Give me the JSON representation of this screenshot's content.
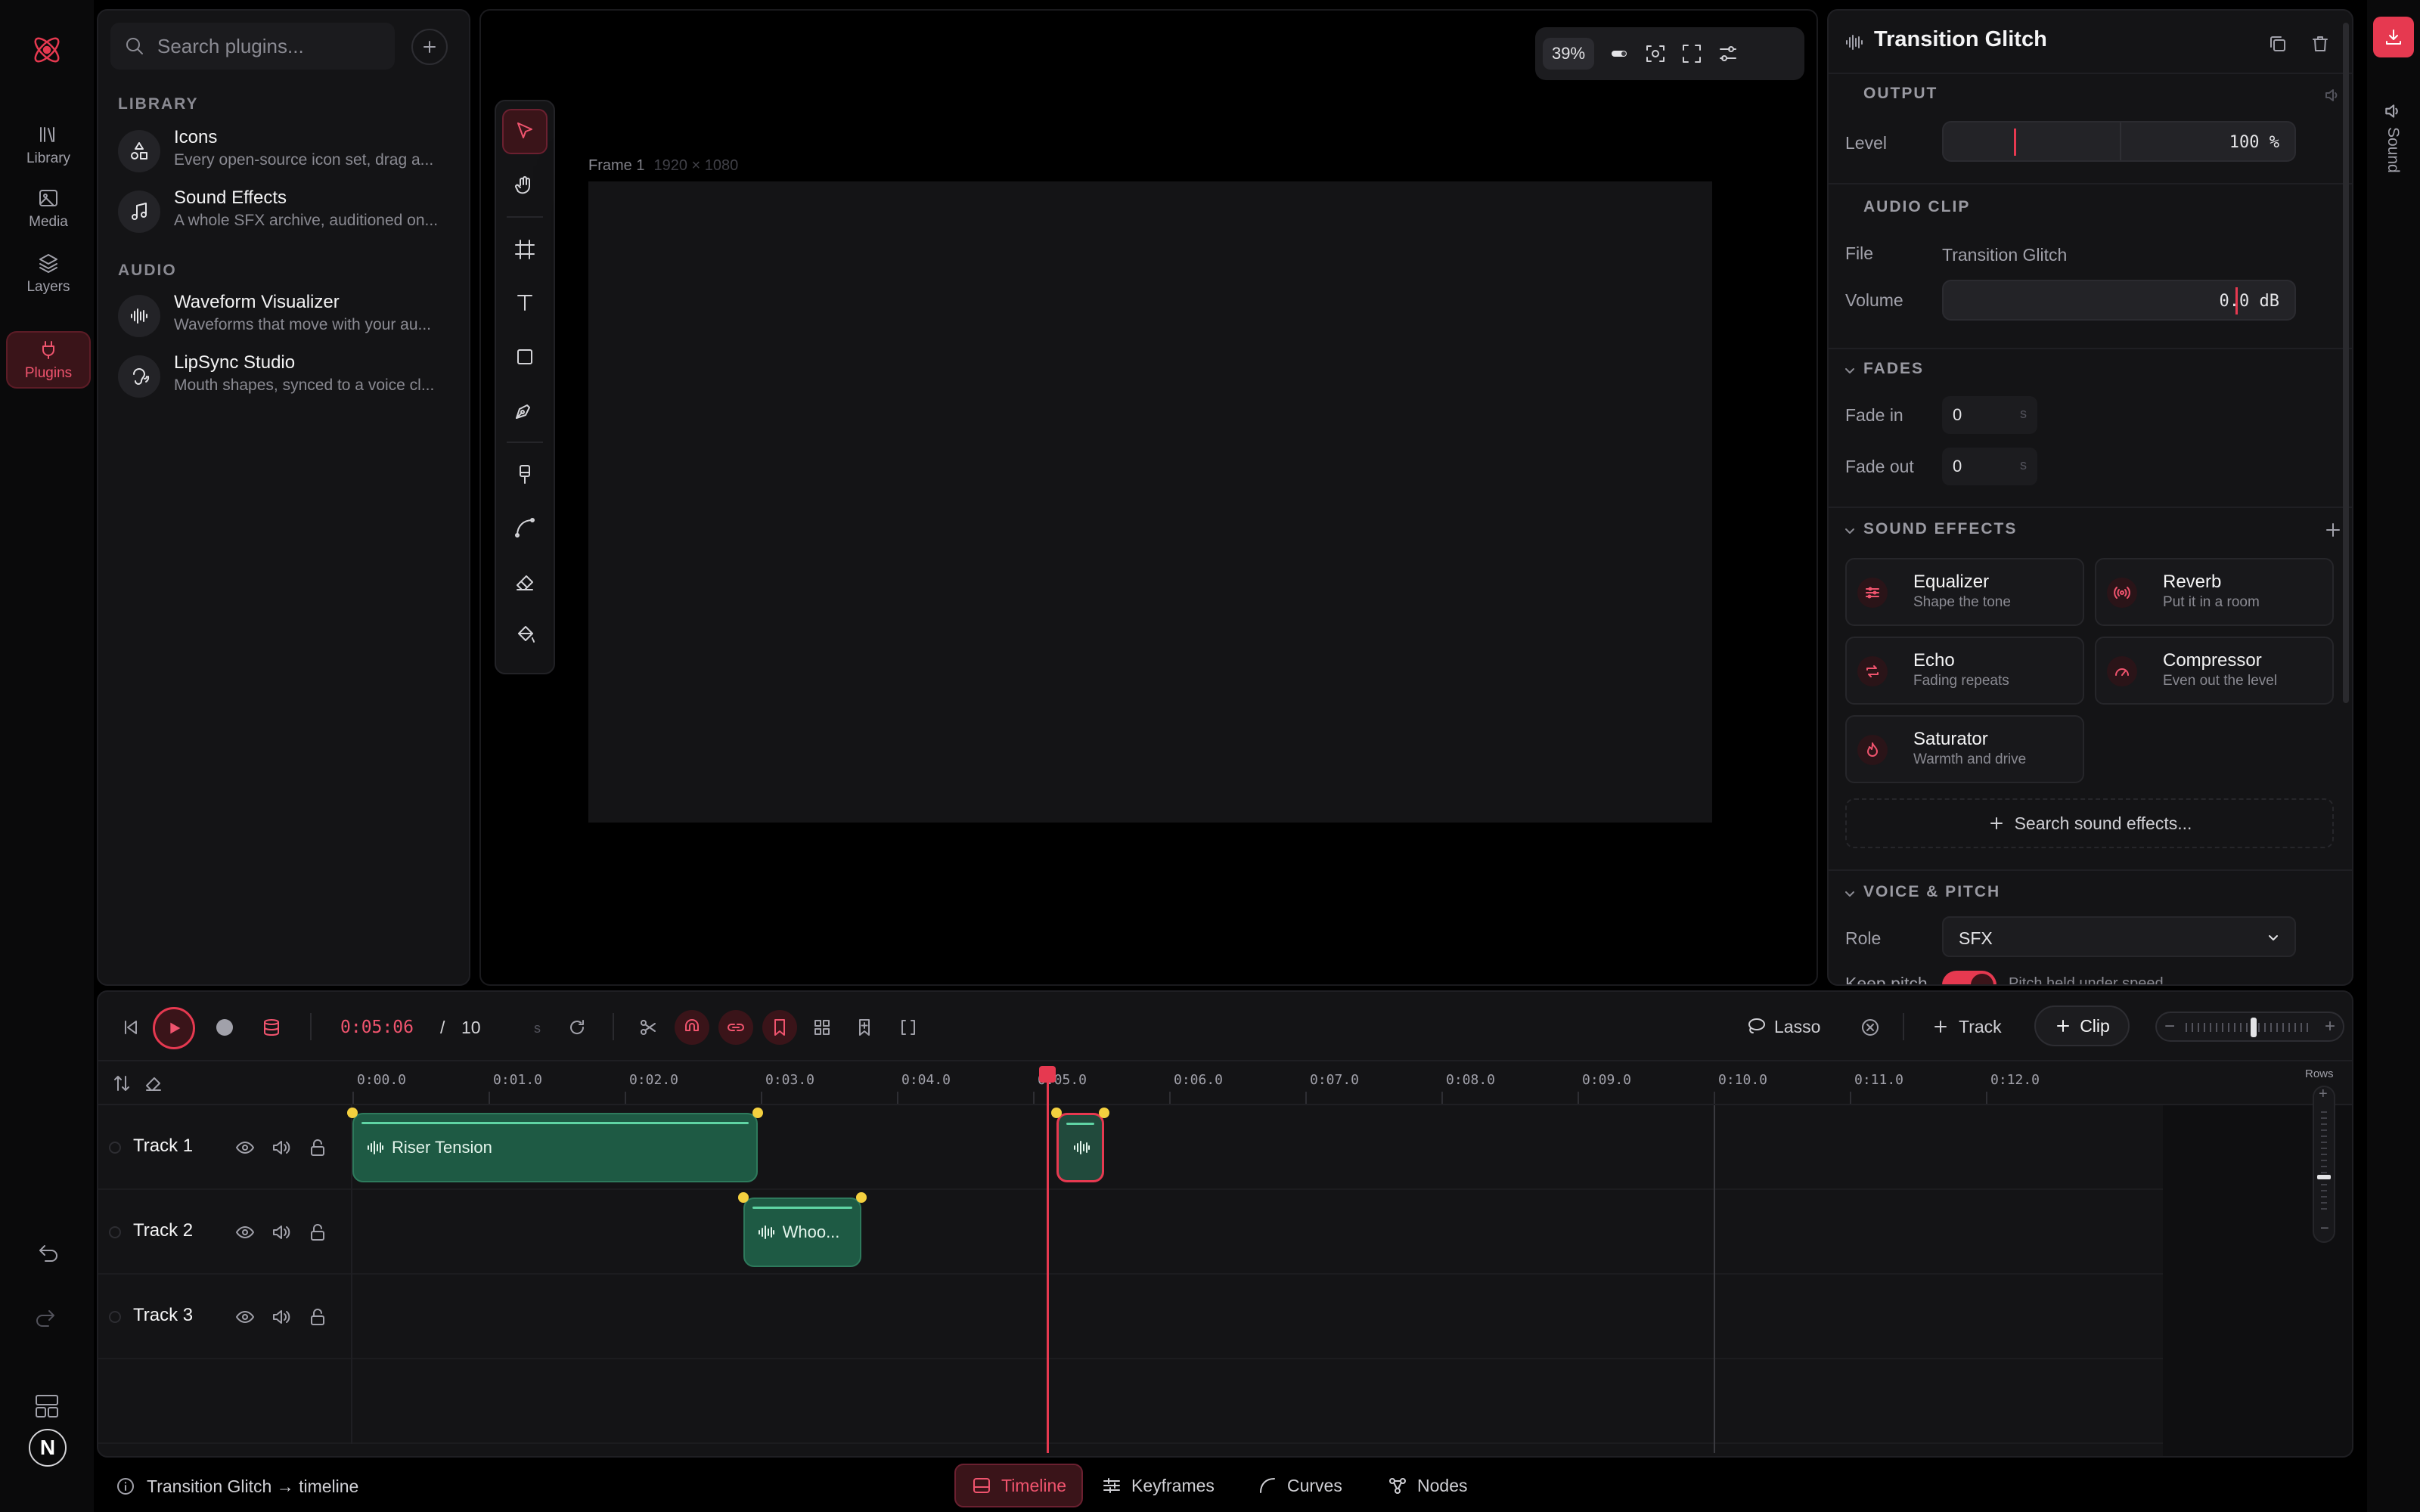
{
  "rail": {
    "items": [
      {
        "label": "Library",
        "icon": "library-icon"
      },
      {
        "label": "Media",
        "icon": "image-icon"
      },
      {
        "label": "Layers",
        "icon": "layers-icon"
      },
      {
        "label": "Plugins",
        "icon": "plug-icon",
        "active": true
      }
    ],
    "avatar": "N"
  },
  "plugins": {
    "search_placeholder": "Search plugins...",
    "sections": [
      {
        "title": "LIBRARY",
        "items": [
          {
            "name": "Icons",
            "desc": "Every open-source icon set, drag a...",
            "icon": "shapes-icon"
          },
          {
            "name": "Sound Effects",
            "desc": "A whole SFX archive, auditioned on...",
            "icon": "music-note-icon"
          }
        ]
      },
      {
        "title": "AUDIO",
        "items": [
          {
            "name": "Waveform Visualizer",
            "desc": "Waveforms that move with your au...",
            "icon": "waveform-icon"
          },
          {
            "name": "LipSync Studio",
            "desc": "Mouth shapes, synced to a voice cl...",
            "icon": "ear-icon"
          }
        ]
      }
    ]
  },
  "canvas": {
    "zoom": "39%",
    "frame_name": "Frame 1",
    "frame_size": "1920 × 1080"
  },
  "props": {
    "title": "Transition Glitch",
    "output": {
      "heading": "OUTPUT",
      "level_label": "Level",
      "level_value": "100",
      "level_unit": "%",
      "level_marker": 0.2
    },
    "audio_clip": {
      "heading": "AUDIO CLIP",
      "file_label": "File",
      "file_value": "Transition Glitch",
      "volume_label": "Volume",
      "volume_value": "0.0",
      "volume_unit": "dB"
    },
    "fades": {
      "heading": "FADES",
      "in_label": "Fade in",
      "in_value": "0",
      "out_label": "Fade out",
      "out_value": "0",
      "unit": "s"
    },
    "sound_effects": {
      "heading": "SOUND EFFECTS",
      "items": [
        {
          "name": "Equalizer",
          "desc": "Shape the tone",
          "icon": "sliders-icon"
        },
        {
          "name": "Reverb",
          "desc": "Put it in a room",
          "icon": "broadcast-icon"
        },
        {
          "name": "Echo",
          "desc": "Fading repeats",
          "icon": "repeat-icon"
        },
        {
          "name": "Compressor",
          "desc": "Even out the level",
          "icon": "gauge-icon"
        },
        {
          "name": "Saturator",
          "desc": "Warmth and drive",
          "icon": "flame-icon"
        }
      ],
      "search_label": "Search sound effects..."
    },
    "voice_pitch": {
      "heading": "VOICE & PITCH",
      "role_label": "Role",
      "role_value": "SFX",
      "keep_label": "Keep pitch",
      "keep_desc": "Pitch held under speed",
      "keep_on": true
    }
  },
  "sidebar_right": {
    "label": "Sound"
  },
  "timeline": {
    "timecode": "0:05:06",
    "separator": "/",
    "duration": "10",
    "duration_unit": "s",
    "lasso_label": "Lasso",
    "track_label": "Track",
    "clip_label": "Clip",
    "ticks": [
      "0:00.0",
      "0:01.0",
      "0:02.0",
      "0:03.0",
      "0:04.0",
      "0:05.0",
      "0:06.0",
      "0:07.0",
      "0:08.0",
      "0:09.0",
      "0:10.0",
      "0:11.0",
      "0:12.0"
    ],
    "rows_label": "Rows",
    "tracks": [
      {
        "name": "Track 1"
      },
      {
        "name": "Track 2"
      },
      {
        "name": "Track 3"
      }
    ],
    "clips": [
      {
        "track": 0,
        "label": "Riser Tension",
        "start": 0.0,
        "end": 2.98
      },
      {
        "track": 1,
        "label": "Whoo...",
        "start": 2.87,
        "end": 3.74
      },
      {
        "track": 0,
        "label": "",
        "start": 5.17,
        "end": 5.52,
        "selected": true
      }
    ]
  },
  "bottom": {
    "status": "Transition Glitch → timeline",
    "tabs": [
      {
        "label": "Timeline",
        "icon": "panel-bottom-icon",
        "active": true
      },
      {
        "label": "Keyframes",
        "icon": "sliders-h-icon"
      },
      {
        "label": "Curves",
        "icon": "curve-icon"
      },
      {
        "label": "Nodes",
        "icon": "nodes-icon"
      }
    ]
  },
  "colors": {
    "accent": "#e63950",
    "clip": "#1e5a44",
    "bg": "#000000"
  }
}
